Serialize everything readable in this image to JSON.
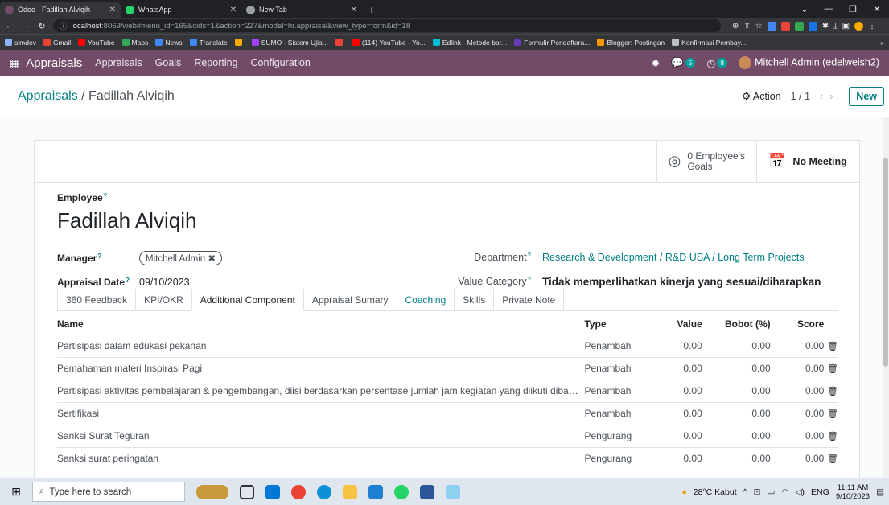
{
  "browser": {
    "tabs": [
      {
        "title": "Odoo - Fadillah Alviqih",
        "icon_color": "#714b67",
        "active": true
      },
      {
        "title": "WhatsApp",
        "icon_color": "#25d366",
        "active": false
      },
      {
        "title": "New Tab",
        "icon_color": "#9aa0a6",
        "active": false
      }
    ],
    "url_host": "localhost",
    "url_rest": ":8069/web#menu_id=165&cids=1&action=227&model=hr.appraisal&view_type=form&id=18",
    "bookmarks": [
      {
        "label": "simdev",
        "color": "#8ab4f8"
      },
      {
        "label": "Gmail",
        "color": "#ea4335"
      },
      {
        "label": "YouTube",
        "color": "#ff0000"
      },
      {
        "label": "Maps",
        "color": "#34a853"
      },
      {
        "label": "News",
        "color": "#4285f4"
      },
      {
        "label": "Translate",
        "color": "#4285f4"
      },
      {
        "label": "",
        "color": "#f9ab00"
      },
      {
        "label": "SUMO - Sistem Ujia...",
        "color": "#a142f4"
      },
      {
        "label": "",
        "color": "#ea4335"
      },
      {
        "label": "(114) YouTube - Yo...",
        "color": "#ff0000"
      },
      {
        "label": "Edlink - Metode bar...",
        "color": "#00bcd4"
      },
      {
        "label": "Formulir Pendaftara...",
        "color": "#673ab7"
      },
      {
        "label": "Blogger: Postingan",
        "color": "#ff9800"
      },
      {
        "label": "Konfirmasi Pembay...",
        "color": "#bdc1c6"
      }
    ]
  },
  "navbar": {
    "app_name": "Appraisals",
    "menu": [
      "Appraisals",
      "Goals",
      "Reporting",
      "Configuration"
    ],
    "messages_count": "5",
    "activities_count": "8",
    "user": "Mitchell Admin (edelweish2)"
  },
  "control": {
    "breadcrumb_parent": "Appraisals",
    "breadcrumb_sep": " / ",
    "breadcrumb_current": "Fadillah Alviqih",
    "action_label": "Action",
    "pager": "1 / 1",
    "new_label": "New"
  },
  "smart_buttons": {
    "goals_count": "0 Employee's",
    "goals_label": "Goals",
    "meeting_label": "No Meeting"
  },
  "form": {
    "employee_label": "Employee",
    "employee_name": "Fadillah Alviqih",
    "manager_label": "Manager",
    "manager_value": "Mitchell Admin",
    "appraisal_date_label": "Appraisal Date",
    "appraisal_date_value": "09/10/2023",
    "department_label": "Department",
    "department_value": "Research & Development / R&D USA / Long Term Projects",
    "value_category_label": "Value Category",
    "value_category_value": "Tidak memperlihatkan kinerja yang sesuai/diharapkan",
    "help_mark": "?"
  },
  "notebook": {
    "tabs": [
      "360 Feedback",
      "KPI/OKR",
      "Additional Component",
      "Appraisal Sumary",
      "Coaching",
      "Skills",
      "Private Note"
    ],
    "active_index": 2
  },
  "table": {
    "headers": {
      "name": "Name",
      "type": "Type",
      "value": "Value",
      "bobot": "Bobot (%)",
      "score": "Score"
    },
    "rows": [
      {
        "name": "Partisipasi dalam edukasi pekanan",
        "type": "Penambah",
        "value": "0.00",
        "bobot": "0.00",
        "score": "0.00"
      },
      {
        "name": "Pemahaman materi Inspirasi Pagi",
        "type": "Penambah",
        "value": "0.00",
        "bobot": "0.00",
        "score": "0.00"
      },
      {
        "name": "Partisipasi aktivitas pembelajaran & pengembangan, diisi berdasarkan persentase jumlah jam kegiatan yang diikuti dibandin...",
        "type": "Penambah",
        "value": "0.00",
        "bobot": "0.00",
        "score": "0.00"
      },
      {
        "name": "Sertifikasi",
        "type": "Penambah",
        "value": "0.00",
        "bobot": "0.00",
        "score": "0.00"
      },
      {
        "name": "Sanksi Surat Teguran",
        "type": "Pengurang",
        "value": "0.00",
        "bobot": "0.00",
        "score": "0.00"
      },
      {
        "name": "Sanksi surat peringatan",
        "type": "Pengurang",
        "value": "0.00",
        "bobot": "0.00",
        "score": "0.00"
      }
    ]
  },
  "taskbar": {
    "search_placeholder": "Type here to search",
    "weather": "28°C Kabut",
    "language": "ENG",
    "time": "11:11 AM",
    "date": "9/10/2023"
  }
}
